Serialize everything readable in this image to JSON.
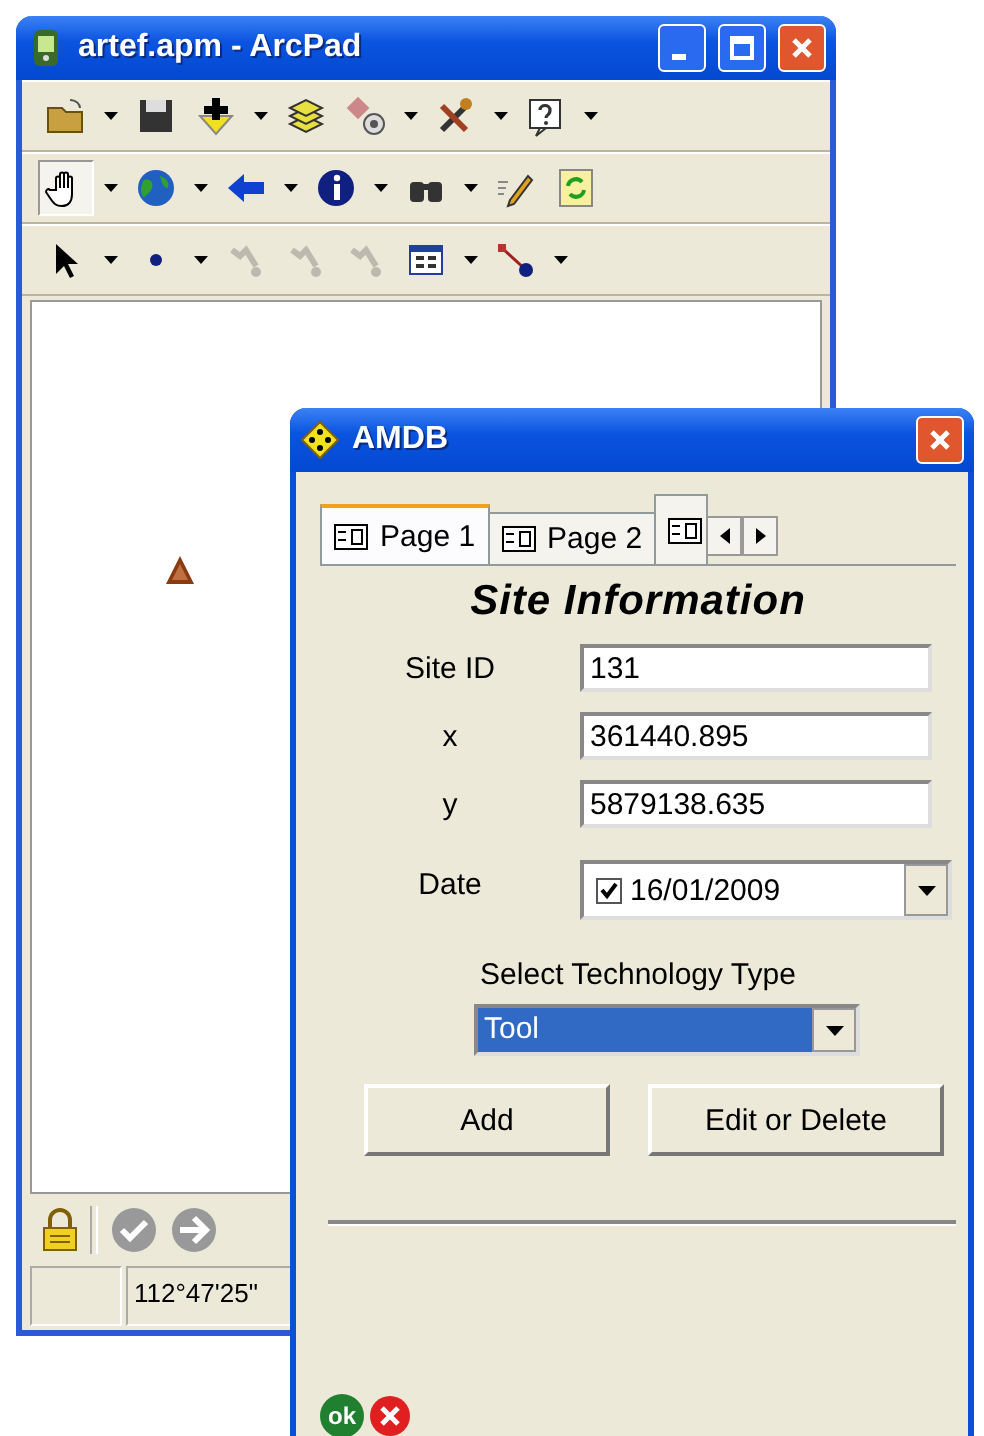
{
  "main_window": {
    "title": "artef.apm - ArcPad",
    "status_bar": {
      "coordinates": "112°47'25\""
    }
  },
  "dialog": {
    "title": "AMDB",
    "tabs": [
      {
        "label": "Page 1",
        "selected": true
      },
      {
        "label": "Page 2",
        "selected": false
      }
    ],
    "heading": "Site Information",
    "fields": [
      {
        "label": "Site ID",
        "value": "131"
      },
      {
        "label": "x",
        "value": "361440.895"
      },
      {
        "label": "y",
        "value": "5879138.635"
      }
    ],
    "date": {
      "label": "Date",
      "checked": true,
      "value": "16/01/2009"
    },
    "technology": {
      "label": "Select Technology Type",
      "value": "Tool"
    },
    "buttons": [
      "Add",
      "Edit or Delete"
    ],
    "ok_label": "ok"
  }
}
